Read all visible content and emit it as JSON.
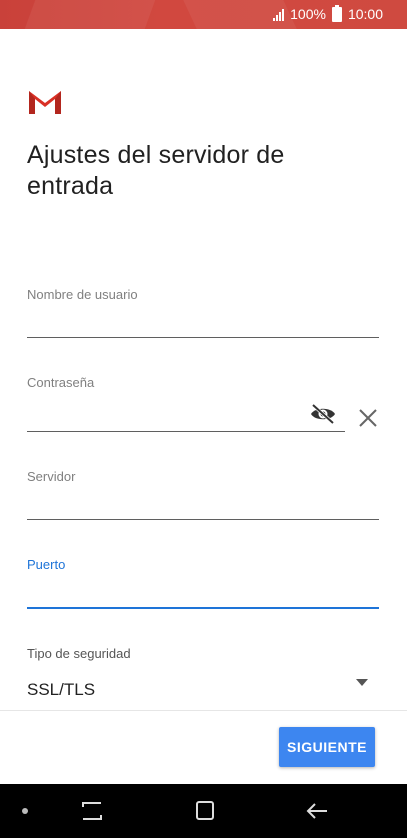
{
  "status_bar": {
    "battery_text": "100%",
    "time": "10:00",
    "icons": [
      "signal-icon",
      "battery-icon"
    ]
  },
  "app": {
    "logo": "gmail-logo",
    "logo_colors": {
      "red": "#d93025",
      "shadow": "#b3261e"
    }
  },
  "page": {
    "title": "Ajustes del servidor de entrada"
  },
  "form": {
    "username": {
      "label": "Nombre de usuario",
      "value": ""
    },
    "password": {
      "label": "Contraseña",
      "value": "",
      "icons": [
        "visibility-off-icon",
        "clear-icon"
      ]
    },
    "server": {
      "label": "Servidor",
      "value": ""
    },
    "port": {
      "label": "Puerto",
      "value": "",
      "focused": true
    },
    "security": {
      "label": "Tipo de seguridad",
      "selected": "SSL/TLS"
    }
  },
  "actions": {
    "next_label": "SIGUIENTE"
  },
  "nav_bar": {
    "buttons": [
      "recents-icon",
      "home-icon",
      "back-icon"
    ]
  },
  "colors": {
    "status_bar": "#cc453d",
    "accent": "#1e74d8",
    "button": "#3d86f0"
  }
}
